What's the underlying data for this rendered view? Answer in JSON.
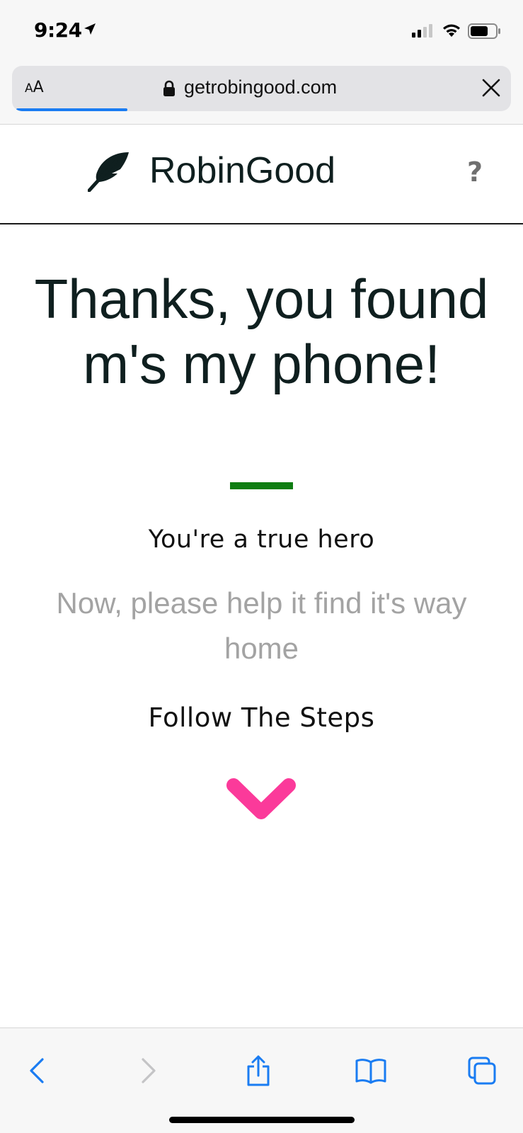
{
  "status_bar": {
    "time": "9:24",
    "icons": [
      "location-arrow-icon",
      "cellular-signal-icon",
      "wifi-icon",
      "battery-icon"
    ]
  },
  "browser": {
    "text_size_button": {
      "small": "A",
      "large": "A"
    },
    "url": "getrobingood.com",
    "url_icon": "lock-icon",
    "close_icon": "close-icon",
    "accent_color": "#1a7cf2"
  },
  "site_header": {
    "brand": "RobinGood",
    "logo_icon": "feather-icon",
    "help_label": "?"
  },
  "main": {
    "headline": "Thanks, you found m's my phone!",
    "divider_color": "#0e7d12",
    "hero_text": "You're a true hero",
    "subtext": "Now, please help it find it's way home",
    "steps_label": "Follow The Steps",
    "chevron_icon": "chevron-down-icon",
    "chevron_color": "#fb3a9a"
  },
  "toolbar": {
    "items": [
      "back-icon",
      "forward-icon",
      "share-icon",
      "bookmarks-icon",
      "tabs-icon"
    ]
  }
}
